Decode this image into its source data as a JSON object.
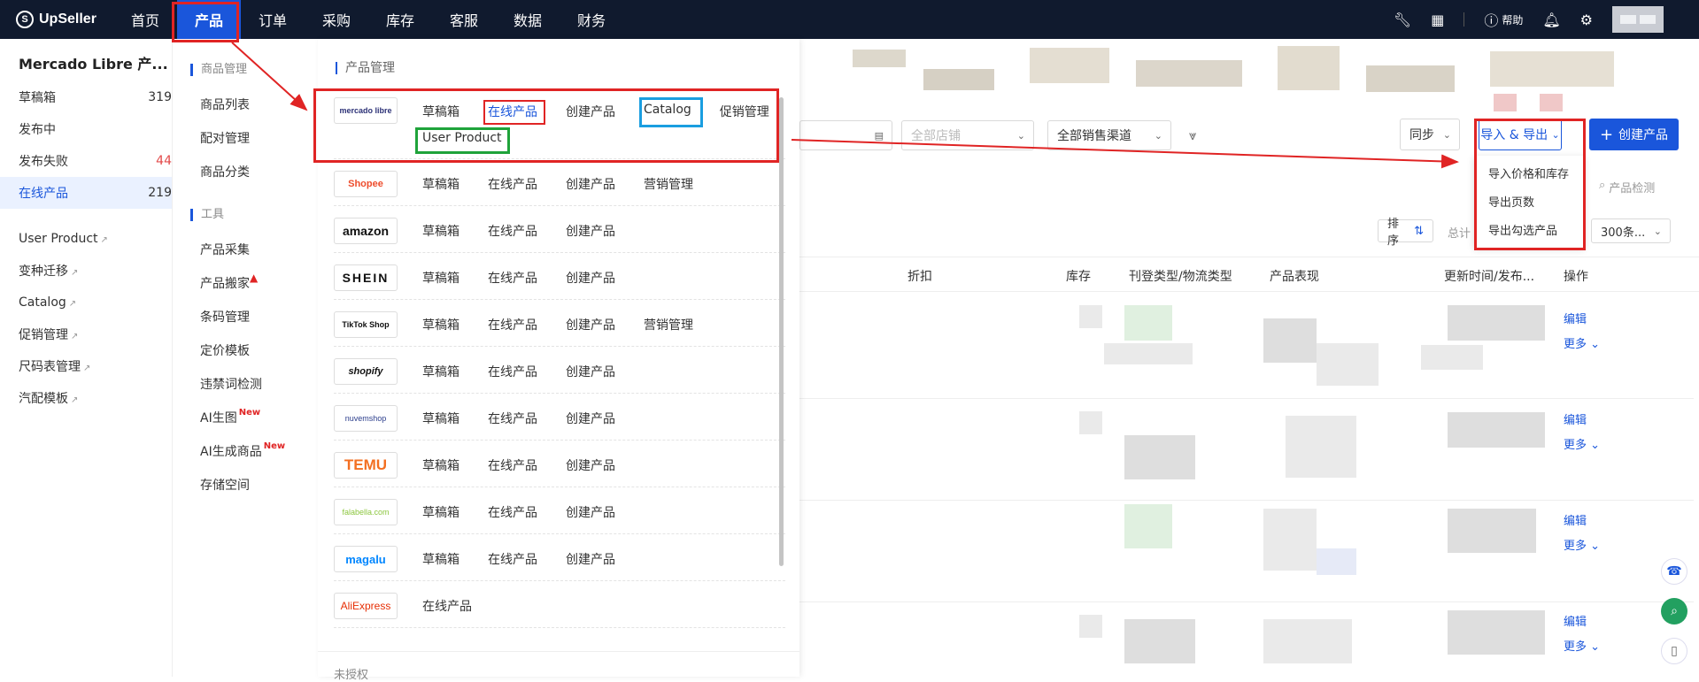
{
  "topbar": {
    "brand": "UpSeller",
    "nav": [
      "首页",
      "产品",
      "订单",
      "采购",
      "库存",
      "客服",
      "数据",
      "财务"
    ],
    "help": "帮助"
  },
  "sidebar": {
    "title": "Mercado Libre 产...",
    "items": [
      {
        "label": "草稿箱",
        "count": "319"
      },
      {
        "label": "发布中",
        "count": ""
      },
      {
        "label": "发布失败",
        "count": "44"
      },
      {
        "label": "在线产品",
        "count": "219"
      }
    ],
    "links": [
      "User Product",
      "变种迁移",
      "Catalog",
      "促销管理",
      "尺码表管理",
      "汽配模板"
    ]
  },
  "menu_left": {
    "group1": "商品管理",
    "group1_items": [
      "商品列表",
      "配对管理",
      "商品分类"
    ],
    "group2": "工具",
    "group2_items": [
      "产品采集",
      "产品搬家",
      "条码管理",
      "定价模板",
      "违禁词检测",
      "AI生图",
      "AI生成商品",
      "存储空间"
    ],
    "new_badge": "New"
  },
  "menu_right": {
    "title": "产品管理",
    "platforms": [
      {
        "logo": "mercado libre",
        "links": [
          "草稿箱",
          "在线产品",
          "创建产品",
          "Catalog",
          "促销管理",
          "User Product"
        ]
      },
      {
        "logo": "Shopee",
        "links": [
          "草稿箱",
          "在线产品",
          "创建产品",
          "营销管理"
        ]
      },
      {
        "logo": "amazon",
        "links": [
          "草稿箱",
          "在线产品",
          "创建产品"
        ]
      },
      {
        "logo": "SHEIN",
        "links": [
          "草稿箱",
          "在线产品",
          "创建产品"
        ]
      },
      {
        "logo": "TikTok Shop",
        "links": [
          "草稿箱",
          "在线产品",
          "创建产品",
          "营销管理"
        ]
      },
      {
        "logo": "shopify",
        "links": [
          "草稿箱",
          "在线产品",
          "创建产品"
        ]
      },
      {
        "logo": "nuvemshop",
        "links": [
          "草稿箱",
          "在线产品",
          "创建产品"
        ]
      },
      {
        "logo": "TEMU",
        "links": [
          "草稿箱",
          "在线产品",
          "创建产品"
        ]
      },
      {
        "logo": "falabella.com",
        "links": [
          "草稿箱",
          "在线产品",
          "创建产品"
        ]
      },
      {
        "logo": "magalu",
        "links": [
          "草稿箱",
          "在线产品",
          "创建产品"
        ]
      },
      {
        "logo": "AliExpress",
        "links": [
          "在线产品"
        ]
      }
    ],
    "unauthorized": "未授权"
  },
  "main": {
    "filters": {
      "shop": "全部店铺",
      "channel": "全部销售渠道"
    },
    "sync": "同步",
    "import_export": "导入 & 导出",
    "create": "创建产品",
    "import_menu": [
      "导入价格和库存",
      "导出页数",
      "导出勾选产品"
    ],
    "product_check": "产品检测",
    "sort": "排序",
    "total": "总计",
    "page_size": "300条...",
    "columns": [
      "折扣",
      "库存",
      "刊登类型/物流类型",
      "产品表现",
      "更新时间/发布...",
      "操作"
    ],
    "edit": "编辑",
    "more": "更多"
  },
  "colors": {
    "primary": "#1a56db",
    "topbar": "#101a2e",
    "highlight": "#e02424"
  }
}
